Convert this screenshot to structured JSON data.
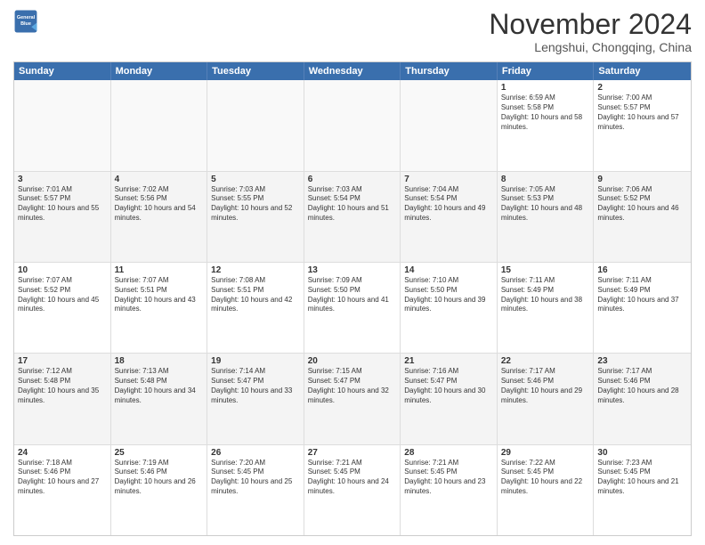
{
  "header": {
    "logo_line1": "General",
    "logo_line2": "Blue",
    "month": "November 2024",
    "location": "Lengshui, Chongqing, China"
  },
  "days_of_week": [
    "Sunday",
    "Monday",
    "Tuesday",
    "Wednesday",
    "Thursday",
    "Friday",
    "Saturday"
  ],
  "weeks": [
    [
      {
        "day": "",
        "info": ""
      },
      {
        "day": "",
        "info": ""
      },
      {
        "day": "",
        "info": ""
      },
      {
        "day": "",
        "info": ""
      },
      {
        "day": "",
        "info": ""
      },
      {
        "day": "1",
        "info": "Sunrise: 6:59 AM\nSunset: 5:58 PM\nDaylight: 10 hours and 58 minutes."
      },
      {
        "day": "2",
        "info": "Sunrise: 7:00 AM\nSunset: 5:57 PM\nDaylight: 10 hours and 57 minutes."
      }
    ],
    [
      {
        "day": "3",
        "info": "Sunrise: 7:01 AM\nSunset: 5:57 PM\nDaylight: 10 hours and 55 minutes."
      },
      {
        "day": "4",
        "info": "Sunrise: 7:02 AM\nSunset: 5:56 PM\nDaylight: 10 hours and 54 minutes."
      },
      {
        "day": "5",
        "info": "Sunrise: 7:03 AM\nSunset: 5:55 PM\nDaylight: 10 hours and 52 minutes."
      },
      {
        "day": "6",
        "info": "Sunrise: 7:03 AM\nSunset: 5:54 PM\nDaylight: 10 hours and 51 minutes."
      },
      {
        "day": "7",
        "info": "Sunrise: 7:04 AM\nSunset: 5:54 PM\nDaylight: 10 hours and 49 minutes."
      },
      {
        "day": "8",
        "info": "Sunrise: 7:05 AM\nSunset: 5:53 PM\nDaylight: 10 hours and 48 minutes."
      },
      {
        "day": "9",
        "info": "Sunrise: 7:06 AM\nSunset: 5:52 PM\nDaylight: 10 hours and 46 minutes."
      }
    ],
    [
      {
        "day": "10",
        "info": "Sunrise: 7:07 AM\nSunset: 5:52 PM\nDaylight: 10 hours and 45 minutes."
      },
      {
        "day": "11",
        "info": "Sunrise: 7:07 AM\nSunset: 5:51 PM\nDaylight: 10 hours and 43 minutes."
      },
      {
        "day": "12",
        "info": "Sunrise: 7:08 AM\nSunset: 5:51 PM\nDaylight: 10 hours and 42 minutes."
      },
      {
        "day": "13",
        "info": "Sunrise: 7:09 AM\nSunset: 5:50 PM\nDaylight: 10 hours and 41 minutes."
      },
      {
        "day": "14",
        "info": "Sunrise: 7:10 AM\nSunset: 5:50 PM\nDaylight: 10 hours and 39 minutes."
      },
      {
        "day": "15",
        "info": "Sunrise: 7:11 AM\nSunset: 5:49 PM\nDaylight: 10 hours and 38 minutes."
      },
      {
        "day": "16",
        "info": "Sunrise: 7:11 AM\nSunset: 5:49 PM\nDaylight: 10 hours and 37 minutes."
      }
    ],
    [
      {
        "day": "17",
        "info": "Sunrise: 7:12 AM\nSunset: 5:48 PM\nDaylight: 10 hours and 35 minutes."
      },
      {
        "day": "18",
        "info": "Sunrise: 7:13 AM\nSunset: 5:48 PM\nDaylight: 10 hours and 34 minutes."
      },
      {
        "day": "19",
        "info": "Sunrise: 7:14 AM\nSunset: 5:47 PM\nDaylight: 10 hours and 33 minutes."
      },
      {
        "day": "20",
        "info": "Sunrise: 7:15 AM\nSunset: 5:47 PM\nDaylight: 10 hours and 32 minutes."
      },
      {
        "day": "21",
        "info": "Sunrise: 7:16 AM\nSunset: 5:47 PM\nDaylight: 10 hours and 30 minutes."
      },
      {
        "day": "22",
        "info": "Sunrise: 7:17 AM\nSunset: 5:46 PM\nDaylight: 10 hours and 29 minutes."
      },
      {
        "day": "23",
        "info": "Sunrise: 7:17 AM\nSunset: 5:46 PM\nDaylight: 10 hours and 28 minutes."
      }
    ],
    [
      {
        "day": "24",
        "info": "Sunrise: 7:18 AM\nSunset: 5:46 PM\nDaylight: 10 hours and 27 minutes."
      },
      {
        "day": "25",
        "info": "Sunrise: 7:19 AM\nSunset: 5:46 PM\nDaylight: 10 hours and 26 minutes."
      },
      {
        "day": "26",
        "info": "Sunrise: 7:20 AM\nSunset: 5:45 PM\nDaylight: 10 hours and 25 minutes."
      },
      {
        "day": "27",
        "info": "Sunrise: 7:21 AM\nSunset: 5:45 PM\nDaylight: 10 hours and 24 minutes."
      },
      {
        "day": "28",
        "info": "Sunrise: 7:21 AM\nSunset: 5:45 PM\nDaylight: 10 hours and 23 minutes."
      },
      {
        "day": "29",
        "info": "Sunrise: 7:22 AM\nSunset: 5:45 PM\nDaylight: 10 hours and 22 minutes."
      },
      {
        "day": "30",
        "info": "Sunrise: 7:23 AM\nSunset: 5:45 PM\nDaylight: 10 hours and 21 minutes."
      }
    ]
  ]
}
